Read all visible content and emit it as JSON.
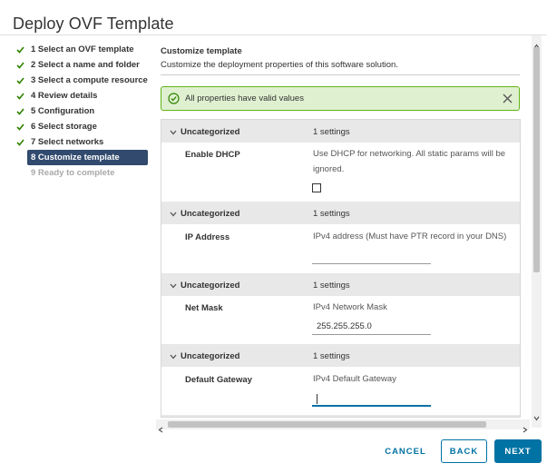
{
  "window": {
    "title": "Deploy OVF Template"
  },
  "steps": [
    {
      "label": "1 Select an OVF template",
      "state": "done"
    },
    {
      "label": "2 Select a name and folder",
      "state": "done"
    },
    {
      "label": "3 Select a compute resource",
      "state": "done"
    },
    {
      "label": "4 Review details",
      "state": "done"
    },
    {
      "label": "5 Configuration",
      "state": "done"
    },
    {
      "label": "6 Select storage",
      "state": "done"
    },
    {
      "label": "7 Select networks",
      "state": "done"
    },
    {
      "label": "8 Customize template",
      "state": "active"
    },
    {
      "label": "9 Ready to complete",
      "state": "disabled"
    }
  ],
  "section": {
    "title": "Customize template",
    "subtitle": "Customize the deployment properties of this software solution."
  },
  "alert": {
    "message": "All properties have valid values"
  },
  "groups": [
    {
      "category": "Uncategorized",
      "count": "1 settings",
      "property": "Enable DHCP",
      "description": "Use DHCP for networking. All static params will be ignored.",
      "control": "checkbox",
      "checked": false
    },
    {
      "category": "Uncategorized",
      "count": "1 settings",
      "property": "IP Address",
      "description": "IPv4 address (Must have PTR record in your DNS)",
      "control": "text",
      "value": ""
    },
    {
      "category": "Uncategorized",
      "count": "1 settings",
      "property": "Net Mask",
      "description": "IPv4 Network Mask",
      "control": "text",
      "value": "255.255.255.0"
    },
    {
      "category": "Uncategorized",
      "count": "1 settings",
      "property": "Default Gateway",
      "description": "IPv4 Default Gateway",
      "control": "text",
      "value": ""
    }
  ],
  "buttons": {
    "cancel": "CANCEL",
    "back": "BACK",
    "next": "NEXT"
  },
  "colors": {
    "accent": "#0072a3",
    "active_step": "#314a6e",
    "success": "#60b515",
    "success_bg": "#dff0d0"
  }
}
